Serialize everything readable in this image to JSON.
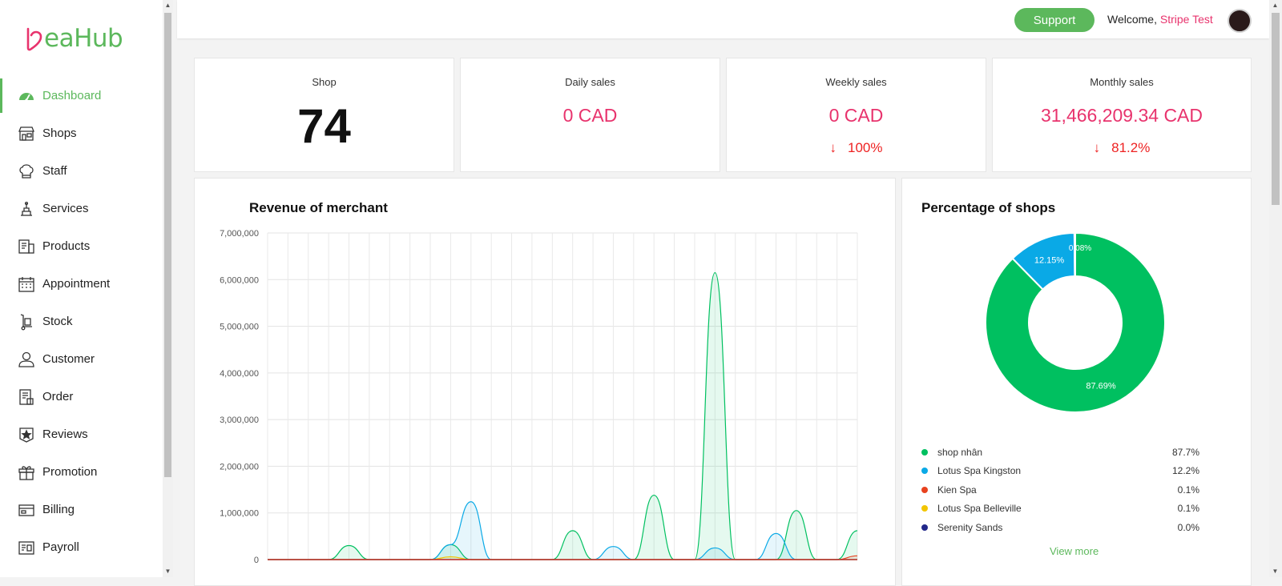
{
  "brand": {
    "name": "eaHub"
  },
  "sidebar": {
    "items": [
      {
        "label": "Dashboard",
        "icon": "speedometer-icon"
      },
      {
        "label": "Shops",
        "icon": "shop-icon"
      },
      {
        "label": "Staff",
        "icon": "chef-hat-icon"
      },
      {
        "label": "Services",
        "icon": "services-icon"
      },
      {
        "label": "Products",
        "icon": "products-icon"
      },
      {
        "label": "Appointment",
        "icon": "calendar-icon"
      },
      {
        "label": "Stock",
        "icon": "hand-truck-icon"
      },
      {
        "label": "Customer",
        "icon": "person-icon"
      },
      {
        "label": "Order",
        "icon": "order-icon"
      },
      {
        "label": "Reviews",
        "icon": "star-badge-icon"
      },
      {
        "label": "Promotion",
        "icon": "gift-icon"
      },
      {
        "label": "Billing",
        "icon": "billing-icon"
      },
      {
        "label": "Payroll",
        "icon": "payroll-icon"
      }
    ]
  },
  "header": {
    "support_label": "Support",
    "welcome_prefix": "Welcome,",
    "user_name": "Stripe Test"
  },
  "stats": {
    "shop": {
      "title": "Shop",
      "value": "74"
    },
    "daily": {
      "title": "Daily sales",
      "value": "0 CAD"
    },
    "weekly": {
      "title": "Weekly sales",
      "value": "0 CAD",
      "change": "100%"
    },
    "monthly": {
      "title": "Monthly sales",
      "value": "31,466,209.34 CAD",
      "change": "81.2%"
    }
  },
  "revenue": {
    "title": "Revenue of merchant"
  },
  "percentage": {
    "title": "Percentage of shops",
    "view_more": "View more",
    "legend": [
      {
        "name": "shop nhân",
        "pct": "87.7%",
        "color": "#00c060"
      },
      {
        "name": "Lotus Spa Kingston",
        "pct": "12.2%",
        "color": "#0aa9e6"
      },
      {
        "name": "Kien Spa",
        "pct": "0.1%",
        "color": "#e8421f"
      },
      {
        "name": "Lotus Spa Belleville",
        "pct": "0.1%",
        "color": "#f2c500"
      },
      {
        "name": "Serenity Sands",
        "pct": "0.0%",
        "color": "#22288a"
      }
    ]
  },
  "chart_data": [
    {
      "type": "area",
      "title": "Revenue of merchant",
      "ylim": [
        0,
        7000000
      ],
      "yticks": [
        "7,000,000",
        "6,000,000",
        "5,000,000",
        "4,000,000",
        "3,000,000",
        "2,000,000",
        "1,000,000",
        "0"
      ],
      "x": [
        0,
        1,
        2,
        3,
        4,
        5,
        6,
        7,
        8,
        9,
        10,
        11,
        12,
        13,
        14,
        15,
        16,
        17,
        18,
        19,
        20,
        21,
        22,
        23,
        24,
        25,
        26,
        27,
        28,
        29
      ],
      "grid": true,
      "series": [
        {
          "color": "#00c060",
          "values": [
            0,
            0,
            0,
            0,
            300000,
            0,
            0,
            0,
            0,
            320000,
            0,
            0,
            0,
            0,
            0,
            620000,
            0,
            0,
            0,
            1380000,
            0,
            0,
            6150000,
            0,
            0,
            0,
            1050000,
            0,
            0,
            620000
          ]
        },
        {
          "color": "#0aa9e6",
          "values": [
            0,
            0,
            0,
            0,
            0,
            0,
            0,
            0,
            0,
            320000,
            1240000,
            0,
            0,
            0,
            0,
            0,
            0,
            280000,
            0,
            0,
            0,
            0,
            250000,
            0,
            0,
            560000,
            0,
            0,
            0,
            0
          ]
        },
        {
          "color": "#f2c500",
          "values": [
            0,
            0,
            0,
            0,
            0,
            0,
            0,
            0,
            0,
            60000,
            0,
            0,
            0,
            0,
            0,
            0,
            0,
            0,
            0,
            0,
            0,
            0,
            0,
            0,
            0,
            0,
            0,
            0,
            0,
            0
          ]
        },
        {
          "color": "#e8421f",
          "values": [
            0,
            0,
            0,
            0,
            0,
            0,
            0,
            0,
            0,
            0,
            0,
            0,
            0,
            0,
            0,
            0,
            0,
            0,
            0,
            0,
            0,
            0,
            0,
            0,
            0,
            0,
            0,
            0,
            0,
            80000
          ]
        }
      ]
    },
    {
      "type": "pie",
      "title": "Percentage of shops",
      "categories": [
        "shop nhân",
        "Lotus Spa Kingston",
        "Kien Spa",
        "Lotus Spa Belleville",
        "Serenity Sands"
      ],
      "values": [
        87.69,
        12.15,
        0.08,
        0.08,
        0.0
      ],
      "labels": [
        "87.69%",
        "12.15%",
        "0.08%",
        "0.08%",
        "0.0%"
      ],
      "colors": [
        "#00c060",
        "#0aa9e6",
        "#e8421f",
        "#f2c500",
        "#22288a"
      ]
    }
  ]
}
